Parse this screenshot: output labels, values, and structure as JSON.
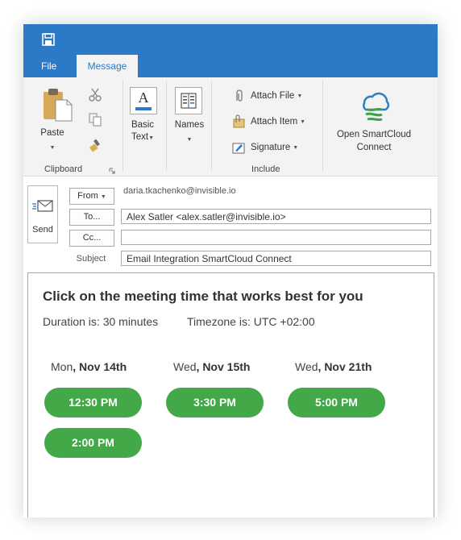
{
  "window": {
    "tabs": [
      "File",
      "Message"
    ],
    "active_tab": "Message",
    "accent_color": "#2b79c7"
  },
  "ribbon": {
    "clipboard": {
      "paste_label": "Paste",
      "group_label": "Clipboard"
    },
    "basic_text_label": [
      "Basic",
      "Text"
    ],
    "names_label": "Names",
    "include": {
      "attach_file": "Attach File",
      "attach_item": "Attach Item",
      "signature": "Signature",
      "group_label": "Include"
    },
    "smartcloud_label": [
      "Open SmartCloud",
      "Connect"
    ]
  },
  "compose": {
    "send_label": "Send",
    "from_label": "From",
    "from_value": "daria.tkachenko@invisible.io",
    "to_label": "To...",
    "to_value": "Alex Satler <alex.satler@invisible.io>",
    "cc_label": "Cc...",
    "cc_value": "",
    "subject_label": "Subject",
    "subject_value": "Email Integration SmartCloud Connect"
  },
  "body": {
    "heading": "Click on the meeting time that works best for you",
    "duration": "Duration is: 30 minutes",
    "timezone": "Timezone is: UTC +02:00",
    "days": [
      {
        "weekday": "Mon",
        "date": ", Nov 14th",
        "slots": [
          "12:30 PM",
          "2:00 PM"
        ]
      },
      {
        "weekday": "Wed",
        "date": ", Nov 15th",
        "slots": [
          "3:30 PM"
        ]
      },
      {
        "weekday": "Wed",
        "date": ", Nov 21th",
        "slots": [
          "5:00 PM"
        ]
      }
    ],
    "slot_color": "#43a848"
  }
}
